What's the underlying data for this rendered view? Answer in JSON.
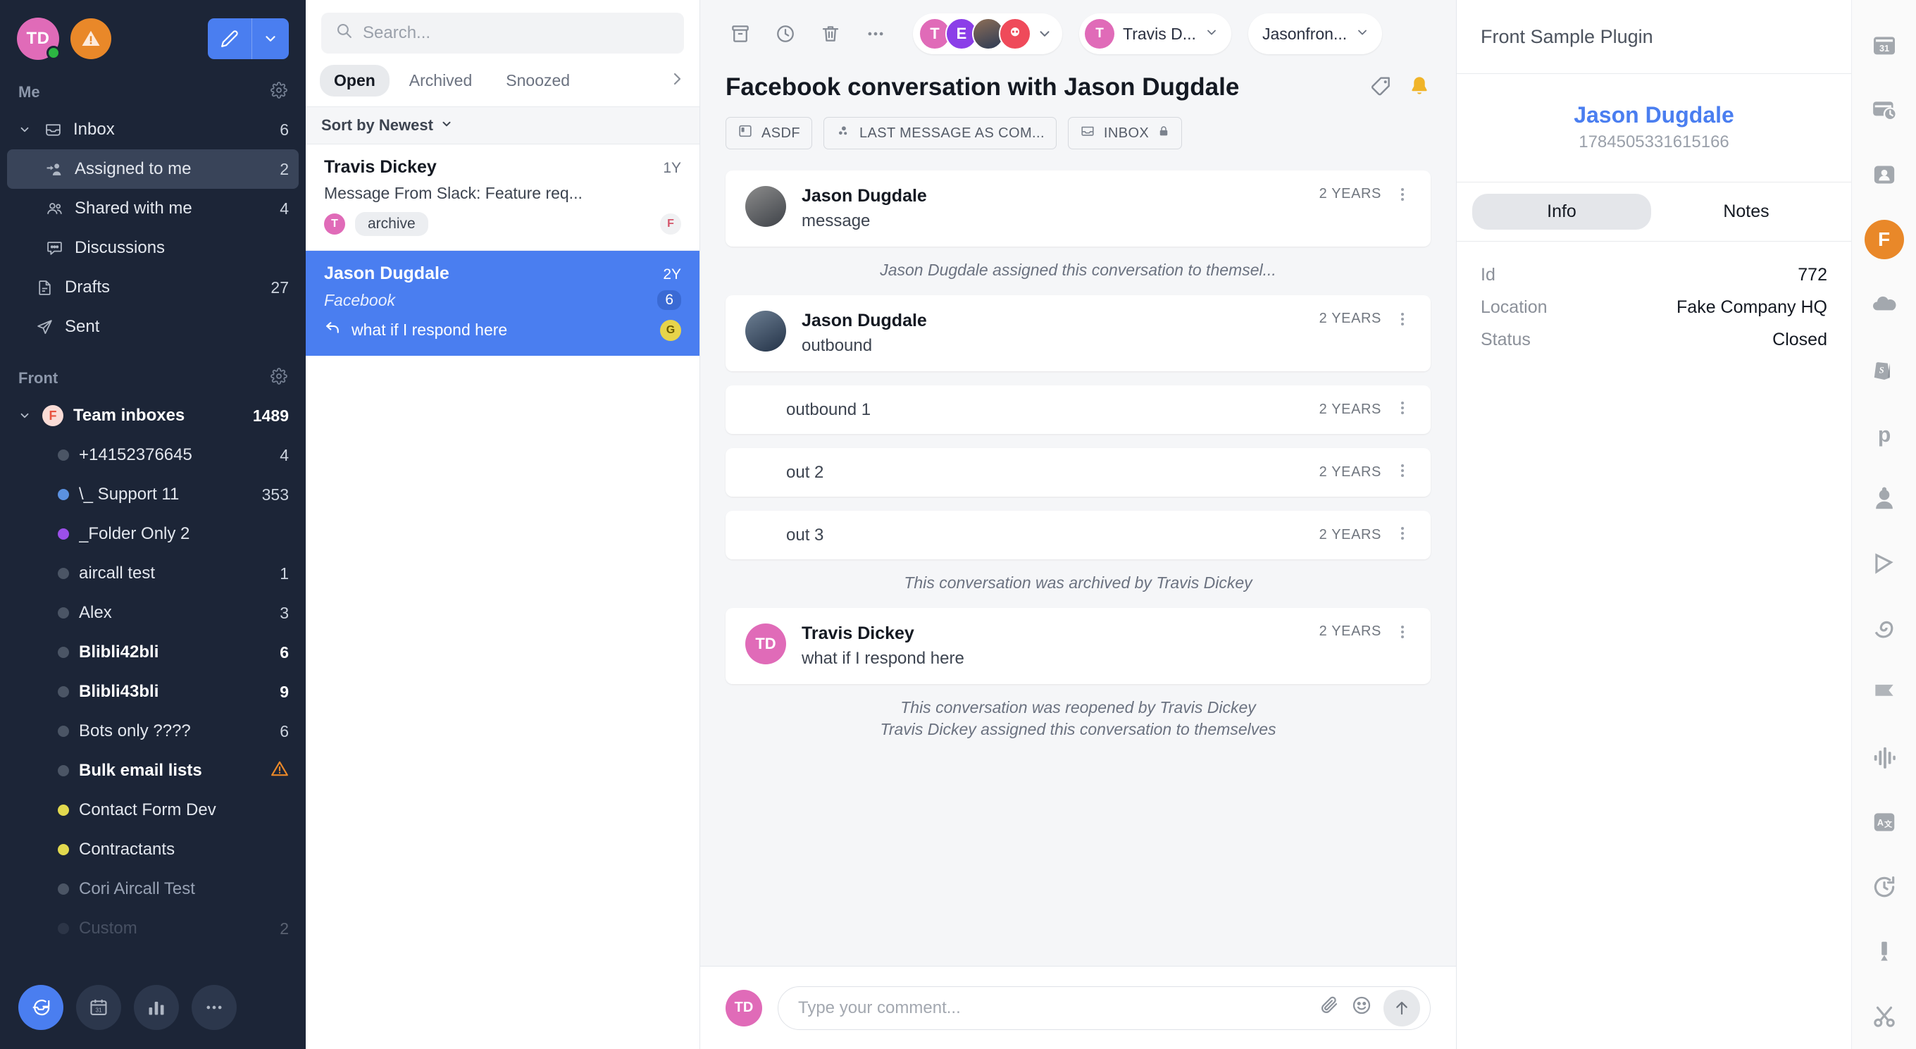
{
  "leftnav": {
    "user_initials": "TD",
    "sections": [
      {
        "title": "Me",
        "items": [
          {
            "label": "Inbox",
            "count": "6",
            "icon": "inbox-icon",
            "level": 1,
            "chevron": true
          },
          {
            "label": "Assigned to me",
            "count": "2",
            "icon": "assigned-icon",
            "level": 2,
            "active": true
          },
          {
            "label": "Shared with me",
            "count": "4",
            "icon": "shared-icon",
            "level": 2
          },
          {
            "label": "Discussions",
            "count": "",
            "icon": "discussion-icon",
            "level": 2
          },
          {
            "label": "Drafts",
            "count": "27",
            "icon": "drafts-icon",
            "level": 1
          },
          {
            "label": "Sent",
            "count": "",
            "icon": "sent-icon",
            "level": 1
          }
        ]
      },
      {
        "title": "Front",
        "items": [
          {
            "label": "Team inboxes",
            "count": "1489",
            "icon": "front-f-icon",
            "level": 1,
            "chevron": true,
            "bold": true
          },
          {
            "label": "+14152376645",
            "count": "4",
            "dot": "#4b5565",
            "level": 2
          },
          {
            "label": "\\_ Support 11",
            "count": "353",
            "dot": "#5b91e0",
            "level": 2
          },
          {
            "label": "_Folder Only 2",
            "count": "",
            "dot": "#9b4fe8",
            "level": 2
          },
          {
            "label": "aircall test",
            "count": "1",
            "dot": "#4b5565",
            "level": 2
          },
          {
            "label": "Alex",
            "count": "3",
            "dot": "#4b5565",
            "level": 2
          },
          {
            "label": "Blibli42bli",
            "count": "6",
            "dot": "#4b5565",
            "level": 2,
            "bold": true
          },
          {
            "label": "Blibli43bli",
            "count": "9",
            "dot": "#4b5565",
            "level": 2,
            "bold": true
          },
          {
            "label": "Bots only ????",
            "count": "6",
            "dot": "#4b5565",
            "level": 2
          },
          {
            "label": "Bulk email lists",
            "count": "",
            "dot": "#4b5565",
            "level": 2,
            "bold": true,
            "warn": true
          },
          {
            "label": "Contact Form Dev",
            "count": "",
            "dot": "#e2d94e",
            "level": 2
          },
          {
            "label": "Contractants",
            "count": "",
            "dot": "#e2d94e",
            "level": 2
          },
          {
            "label": "Cori Aircall Test",
            "count": "",
            "dot": "#4b5565",
            "level": 2,
            "dim": true
          },
          {
            "label": "Custom",
            "count": "2",
            "dot": "#4b5565",
            "level": 2,
            "dim": true
          }
        ]
      }
    ],
    "bottom_buttons": [
      "inbox-bubble-icon",
      "calendar-31-icon",
      "analytics-icon",
      "more-dots-icon"
    ]
  },
  "convlist": {
    "search_placeholder": "Search...",
    "tabs": [
      {
        "label": "Open",
        "active": true
      },
      {
        "label": "Archived",
        "active": false
      },
      {
        "label": "Snoozed",
        "active": false
      }
    ],
    "sort_label": "Sort by Newest",
    "conversations": [
      {
        "name": "Travis Dickey",
        "time": "1Y",
        "preview": "Message From Slack: Feature req...",
        "avatar_initial": "T",
        "tag": "archive",
        "right_avatar": "F",
        "selected": false
      },
      {
        "name": "Jason Dugdale",
        "time": "2Y",
        "preview": "Facebook",
        "count": "6",
        "reply_text": "what if I respond here",
        "right_avatar": "G",
        "selected": true
      }
    ]
  },
  "main": {
    "toolbar_icons": [
      "archive-icon",
      "snooze-clock-icon",
      "trash-icon",
      "more-dots-icon"
    ],
    "assignee_stack": [
      {
        "initial": "T",
        "color": "#e06bb8"
      },
      {
        "initial": "E",
        "color": "#8b3ee8"
      },
      {
        "initial": "",
        "color": "#7a5c48"
      },
      {
        "initial": "",
        "color": "#ef4a5a"
      }
    ],
    "assignee_pill": {
      "initial": "T",
      "label": "Travis D..."
    },
    "inbox_pill": {
      "label": "Jasonfron..."
    },
    "subject": "Facebook conversation with Jason Dugdale",
    "subject_icons": [
      "tag-icon",
      "bell-icon"
    ],
    "meta_buttons": [
      {
        "label": "ASDF",
        "icon": "board-icon"
      },
      {
        "label": "LAST MESSAGE AS COM...",
        "icon": "dots-cluster-icon"
      },
      {
        "label": "INBOX",
        "icon": "inbox-icon",
        "lock": true
      }
    ],
    "messages": [
      {
        "kind": "message",
        "name": "Jason Dugdale",
        "text": "message",
        "time": "2 YEARS",
        "avatar_color": "#5a5f66",
        "avatar_initial": ""
      },
      {
        "kind": "system",
        "text": "Jason Dugdale assigned this conversation to themsel..."
      },
      {
        "kind": "message",
        "name": "Jason Dugdale",
        "text": "outbound",
        "time": "2 YEARS",
        "avatar_color": "#37506b",
        "avatar_initial": ""
      },
      {
        "kind": "compact",
        "text": "outbound 1",
        "time": "2 YEARS"
      },
      {
        "kind": "compact",
        "text": "out 2",
        "time": "2 YEARS"
      },
      {
        "kind": "compact",
        "text": "out 3",
        "time": "2 YEARS"
      },
      {
        "kind": "system",
        "text": "This conversation was archived by Travis Dickey"
      },
      {
        "kind": "message",
        "name": "Travis Dickey",
        "text": "what if I respond here",
        "time": "2 YEARS",
        "avatar_color": "#e06bb8",
        "avatar_initial": "TD"
      },
      {
        "kind": "system",
        "text": "This conversation was reopened by Travis Dickey"
      },
      {
        "kind": "system",
        "text": "Travis Dickey assigned this conversation to themselves"
      }
    ],
    "composer": {
      "avatar_initials": "TD",
      "placeholder": "Type your comment...",
      "icons": [
        "attachment-icon",
        "emoji-icon",
        "send-arrow-icon"
      ]
    }
  },
  "plugin": {
    "title": "Front Sample Plugin",
    "contact_name": "Jason Dugdale",
    "contact_id": "1784505331615166",
    "tabs": [
      {
        "label": "Info",
        "active": true
      },
      {
        "label": "Notes",
        "active": false
      }
    ],
    "rows": [
      {
        "key": "Id",
        "value": "772"
      },
      {
        "key": "Location",
        "value": "Fake Company HQ"
      },
      {
        "key": "Status",
        "value": "Closed"
      }
    ]
  },
  "rail": {
    "items": [
      "calendar-31-icon",
      "wallet-clock-icon",
      "contact-card-icon",
      "front-f-icon",
      "cloud-icon",
      "shopify-icon",
      "pipedrive-p-icon",
      "person-avatar-icon",
      "flag-icon",
      "spiral-icon",
      "flag-folded-icon",
      "waveform-icon",
      "translate-icon",
      "clock-refresh-icon",
      "pin-icon",
      "scissors-icon"
    ],
    "active_index": 3,
    "accent_color": "#e98829"
  },
  "colors": {
    "nav_bg": "#1c2537",
    "accent_blue": "#4a7ef0",
    "selected_conv": "#4a7ef0",
    "brand_orange": "#e98829",
    "avatar_pink": "#e06bb8"
  }
}
